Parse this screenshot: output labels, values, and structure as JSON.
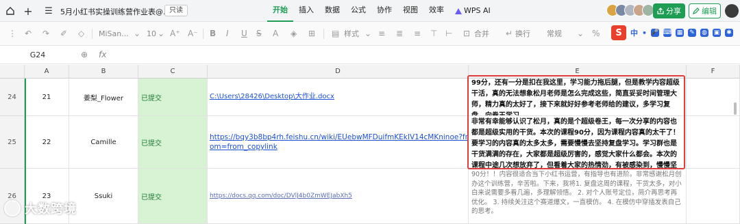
{
  "titlebar": {
    "doc_title": "5月小红书实操训练营作业表@...",
    "readonly_label": "只读",
    "menu": [
      "开始",
      "插入",
      "数据",
      "公式",
      "协作",
      "视图",
      "效率",
      "WPS AI"
    ],
    "share_label": "分享",
    "edit_label": "编辑"
  },
  "toolbar": {
    "font_name": "MiSan...",
    "font_size": "10",
    "style_label": "样式",
    "merge_label": "合并",
    "wrap_label": "换行",
    "format_label": "常规",
    "ime_items": [
      "中",
      "•",
      "🎤",
      "⌨",
      "▦",
      "✎",
      "◍",
      "▣",
      "✱"
    ]
  },
  "formula_bar": {
    "cell_ref": "G24",
    "fx_label": "fx"
  },
  "columns": [
    "A",
    "B",
    "C",
    "D",
    "E",
    "F"
  ],
  "rows": [
    {
      "row_num": "24",
      "a": "21",
      "b": "姜梨_Flower",
      "c": "已提交",
      "d": "C:\\Users\\28426\\Desktop\\大作业.docx",
      "e": "99分，还有一分是扣在我这里，学习能力拖后腿，但是教学内容超级干活，真的无法想象松月老师是怎么完成这些，简直妥妥时间管理大师，精力真的太好了，接下来就好好参考老师给的建议，多学习复盘，向卷王学习"
    },
    {
      "row_num": "25",
      "a": "22",
      "b": "Camille",
      "c": "已提交",
      "d": "https://bqy3b8bp4rh.feishu.cn/wiki/EUebwMFDuifmKEkIV14cMKninoe?from=from_copylink",
      "e": "非常有幸能够认识了松月，真的是个超级卷王，每一次分享的内容也都是超级实用的干货。本次的课程90分，因为课程内容真的太干了！要学习的内容真的太多太多，需要慢慢去坚持复盘学习。学习群也是干货满满的存在，大家都是超级厉害的，感觉大家什么都会。本次的课程中途几次想放弃了，但看着大家的热情劲，有被感染到，慢慢坚持下来了。"
    },
    {
      "row_num": "26",
      "a": "23",
      "b": "Ssuki",
      "c": "已提交",
      "d": "https://docs.qq.com/doc/DVlJ4b0ZmWEJabXh5",
      "e": "90分！！内容很适合当下小红书运营，有指导也有进阶。非常感谢松月创办这个训练营，辛苦啦。下来，我将1. 复盘这周的课程，干货太多，对小白来说需要多看几遍，多理解领悟。 2. 对个人账号定位，简介再思考再优化。 3. 持续关注这个赛道爆文，一直模仿。 4. 在模仿中穿插发表自己的思考。"
    }
  ],
  "watermark": {
    "text": "大数跨境"
  }
}
